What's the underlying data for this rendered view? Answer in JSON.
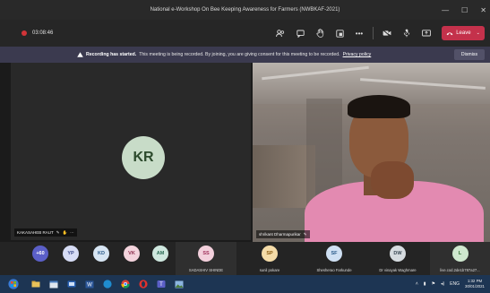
{
  "window": {
    "title": "National e-Workshop On Bee Keeping Awareness for Farmers (NWBKAF-2021)",
    "controls": [
      "—",
      "☐",
      "✕"
    ]
  },
  "toolbar": {
    "timer": "03:08:46",
    "leave_label": "Leave",
    "icons": [
      "participants-icon",
      "chat-icon",
      "raise-hand-icon",
      "breakout-icon",
      "more-icon",
      "camera-icon",
      "mic-icon",
      "share-icon"
    ]
  },
  "banner": {
    "bold": "Recording has started.",
    "text": "This meeting is being recorded. By joining, you are giving consent for this meeting to be recorded.",
    "link": "Privacy policy",
    "dismiss": "Dismiss"
  },
  "stage": {
    "left_initials": "KR",
    "left_name": "KAKASAHEB RAUT",
    "left_extra": "···",
    "right_name": "shrikant Dharmapurikar"
  },
  "strip": {
    "overflow": "+60",
    "small": [
      "YP",
      "KD",
      "VK",
      "AM"
    ],
    "named": [
      {
        "initials": "SS",
        "name": "SADASHIV SHINDE"
      },
      {
        "initials": "SP",
        "name": "sunil pokare"
      },
      {
        "initials": "SF",
        "name": "Shesherao Farkunde"
      },
      {
        "initials": "DW",
        "name": "Dr vinayak Waghmare"
      },
      {
        "initials": "L",
        "name": "live.cod.2de1b787a27..."
      }
    ]
  },
  "taskbar": {
    "time": "1:32 PM",
    "date": "30/01/2021"
  },
  "colors": {
    "leave": "#c4314b",
    "recording": "#d13438",
    "banner": "#3b3a4f",
    "taskbar": "#1d3553"
  }
}
